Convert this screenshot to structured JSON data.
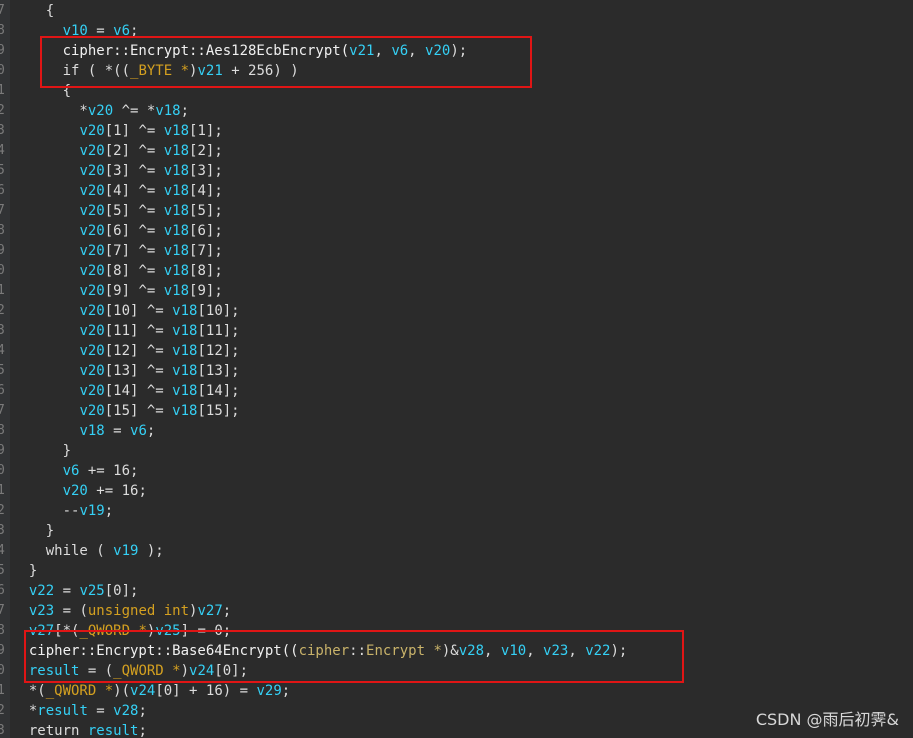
{
  "gutter": {
    "line_numbers": [
      "7",
      "8",
      "9",
      "0",
      "1",
      "2",
      "3",
      "4",
      "5",
      "6",
      "7",
      "8",
      "9",
      "0",
      "1",
      "2",
      "3",
      "4",
      "5",
      "6",
      "7",
      "8",
      "9",
      "0",
      "1",
      "2",
      "3",
      "4",
      "5",
      "6",
      "7",
      "8",
      "9",
      "0",
      "1",
      "2",
      "3"
    ]
  },
  "code": {
    "lines": [
      [
        {
          "t": "    {",
          "c": "plain"
        }
      ],
      [
        {
          "t": "      ",
          "c": "plain"
        },
        {
          "t": "v10",
          "c": "var"
        },
        {
          "t": " = ",
          "c": "plain"
        },
        {
          "t": "v6",
          "c": "var"
        },
        {
          "t": ";",
          "c": "plain"
        }
      ],
      [
        {
          "t": "      cipher::Encrypt::Aes128EcbEncrypt(",
          "c": "fn"
        },
        {
          "t": "v21",
          "c": "var"
        },
        {
          "t": ", ",
          "c": "plain"
        },
        {
          "t": "v6",
          "c": "var"
        },
        {
          "t": ", ",
          "c": "plain"
        },
        {
          "t": "v20",
          "c": "var"
        },
        {
          "t": ");",
          "c": "plain"
        }
      ],
      [
        {
          "t": "      if ( *((",
          "c": "plain"
        },
        {
          "t": "_BYTE *",
          "c": "kw"
        },
        {
          "t": ")",
          "c": "plain"
        },
        {
          "t": "v21",
          "c": "var"
        },
        {
          "t": " + 256) )",
          "c": "plain"
        }
      ],
      [
        {
          "t": "      {",
          "c": "plain"
        }
      ],
      [
        {
          "t": "        *",
          "c": "plain"
        },
        {
          "t": "v20",
          "c": "var"
        },
        {
          "t": " ^= *",
          "c": "plain"
        },
        {
          "t": "v18",
          "c": "var"
        },
        {
          "t": ";",
          "c": "plain"
        }
      ],
      [
        {
          "t": "        ",
          "c": "plain"
        },
        {
          "t": "v20",
          "c": "var"
        },
        {
          "t": "[1] ^= ",
          "c": "plain"
        },
        {
          "t": "v18",
          "c": "var"
        },
        {
          "t": "[1];",
          "c": "plain"
        }
      ],
      [
        {
          "t": "        ",
          "c": "plain"
        },
        {
          "t": "v20",
          "c": "var"
        },
        {
          "t": "[2] ^= ",
          "c": "plain"
        },
        {
          "t": "v18",
          "c": "var"
        },
        {
          "t": "[2];",
          "c": "plain"
        }
      ],
      [
        {
          "t": "        ",
          "c": "plain"
        },
        {
          "t": "v20",
          "c": "var"
        },
        {
          "t": "[3] ^= ",
          "c": "plain"
        },
        {
          "t": "v18",
          "c": "var"
        },
        {
          "t": "[3];",
          "c": "plain"
        }
      ],
      [
        {
          "t": "        ",
          "c": "plain"
        },
        {
          "t": "v20",
          "c": "var"
        },
        {
          "t": "[4] ^= ",
          "c": "plain"
        },
        {
          "t": "v18",
          "c": "var"
        },
        {
          "t": "[4];",
          "c": "plain"
        }
      ],
      [
        {
          "t": "        ",
          "c": "plain"
        },
        {
          "t": "v20",
          "c": "var"
        },
        {
          "t": "[5] ^= ",
          "c": "plain"
        },
        {
          "t": "v18",
          "c": "var"
        },
        {
          "t": "[5];",
          "c": "plain"
        }
      ],
      [
        {
          "t": "        ",
          "c": "plain"
        },
        {
          "t": "v20",
          "c": "var"
        },
        {
          "t": "[6] ^= ",
          "c": "plain"
        },
        {
          "t": "v18",
          "c": "var"
        },
        {
          "t": "[6];",
          "c": "plain"
        }
      ],
      [
        {
          "t": "        ",
          "c": "plain"
        },
        {
          "t": "v20",
          "c": "var"
        },
        {
          "t": "[7] ^= ",
          "c": "plain"
        },
        {
          "t": "v18",
          "c": "var"
        },
        {
          "t": "[7];",
          "c": "plain"
        }
      ],
      [
        {
          "t": "        ",
          "c": "plain"
        },
        {
          "t": "v20",
          "c": "var"
        },
        {
          "t": "[8] ^= ",
          "c": "plain"
        },
        {
          "t": "v18",
          "c": "var"
        },
        {
          "t": "[8];",
          "c": "plain"
        }
      ],
      [
        {
          "t": "        ",
          "c": "plain"
        },
        {
          "t": "v20",
          "c": "var"
        },
        {
          "t": "[9] ^= ",
          "c": "plain"
        },
        {
          "t": "v18",
          "c": "var"
        },
        {
          "t": "[9];",
          "c": "plain"
        }
      ],
      [
        {
          "t": "        ",
          "c": "plain"
        },
        {
          "t": "v20",
          "c": "var"
        },
        {
          "t": "[10] ^= ",
          "c": "plain"
        },
        {
          "t": "v18",
          "c": "var"
        },
        {
          "t": "[10];",
          "c": "plain"
        }
      ],
      [
        {
          "t": "        ",
          "c": "plain"
        },
        {
          "t": "v20",
          "c": "var"
        },
        {
          "t": "[11] ^= ",
          "c": "plain"
        },
        {
          "t": "v18",
          "c": "var"
        },
        {
          "t": "[11];",
          "c": "plain"
        }
      ],
      [
        {
          "t": "        ",
          "c": "plain"
        },
        {
          "t": "v20",
          "c": "var"
        },
        {
          "t": "[12] ^= ",
          "c": "plain"
        },
        {
          "t": "v18",
          "c": "var"
        },
        {
          "t": "[12];",
          "c": "plain"
        }
      ],
      [
        {
          "t": "        ",
          "c": "plain"
        },
        {
          "t": "v20",
          "c": "var"
        },
        {
          "t": "[13] ^= ",
          "c": "plain"
        },
        {
          "t": "v18",
          "c": "var"
        },
        {
          "t": "[13];",
          "c": "plain"
        }
      ],
      [
        {
          "t": "        ",
          "c": "plain"
        },
        {
          "t": "v20",
          "c": "var"
        },
        {
          "t": "[14] ^= ",
          "c": "plain"
        },
        {
          "t": "v18",
          "c": "var"
        },
        {
          "t": "[14];",
          "c": "plain"
        }
      ],
      [
        {
          "t": "        ",
          "c": "plain"
        },
        {
          "t": "v20",
          "c": "var"
        },
        {
          "t": "[15] ^= ",
          "c": "plain"
        },
        {
          "t": "v18",
          "c": "var"
        },
        {
          "t": "[15];",
          "c": "plain"
        }
      ],
      [
        {
          "t": "        ",
          "c": "plain"
        },
        {
          "t": "v18",
          "c": "var"
        },
        {
          "t": " = ",
          "c": "plain"
        },
        {
          "t": "v6",
          "c": "var"
        },
        {
          "t": ";",
          "c": "plain"
        }
      ],
      [
        {
          "t": "      }",
          "c": "plain"
        }
      ],
      [
        {
          "t": "      ",
          "c": "plain"
        },
        {
          "t": "v6",
          "c": "var"
        },
        {
          "t": " += 16;",
          "c": "plain"
        }
      ],
      [
        {
          "t": "      ",
          "c": "plain"
        },
        {
          "t": "v20",
          "c": "var"
        },
        {
          "t": " += 16;",
          "c": "plain"
        }
      ],
      [
        {
          "t": "      --",
          "c": "plain"
        },
        {
          "t": "v19",
          "c": "var"
        },
        {
          "t": ";",
          "c": "plain"
        }
      ],
      [
        {
          "t": "    }",
          "c": "plain"
        }
      ],
      [
        {
          "t": "    while ( ",
          "c": "plain"
        },
        {
          "t": "v19",
          "c": "var"
        },
        {
          "t": " );",
          "c": "plain"
        }
      ],
      [
        {
          "t": "  }",
          "c": "plain"
        }
      ],
      [
        {
          "t": "  ",
          "c": "plain"
        },
        {
          "t": "v22",
          "c": "var"
        },
        {
          "t": " = ",
          "c": "plain"
        },
        {
          "t": "v25",
          "c": "var"
        },
        {
          "t": "[0];",
          "c": "plain"
        }
      ],
      [
        {
          "t": "  ",
          "c": "plain"
        },
        {
          "t": "v23",
          "c": "var"
        },
        {
          "t": " = (",
          "c": "plain"
        },
        {
          "t": "unsigned int",
          "c": "kw"
        },
        {
          "t": ")",
          "c": "plain"
        },
        {
          "t": "v27",
          "c": "var"
        },
        {
          "t": ";",
          "c": "plain"
        }
      ],
      [
        {
          "t": "  ",
          "c": "plain"
        },
        {
          "t": "v27",
          "c": "var"
        },
        {
          "t": "[*(",
          "c": "plain"
        },
        {
          "t": "_QWORD *",
          "c": "kw"
        },
        {
          "t": ")",
          "c": "plain"
        },
        {
          "t": "v25",
          "c": "var"
        },
        {
          "t": "] = 0;",
          "c": "plain"
        }
      ],
      [
        {
          "t": "  cipher::Encrypt::Base64Encrypt((",
          "c": "fn"
        },
        {
          "t": "cipher",
          "c": "ns"
        },
        {
          "t": "::",
          "c": "plain"
        },
        {
          "t": "Encrypt *",
          "c": "ns"
        },
        {
          "t": ")&",
          "c": "plain"
        },
        {
          "t": "v28",
          "c": "var"
        },
        {
          "t": ", ",
          "c": "plain"
        },
        {
          "t": "v10",
          "c": "var"
        },
        {
          "t": ", ",
          "c": "plain"
        },
        {
          "t": "v23",
          "c": "var"
        },
        {
          "t": ", ",
          "c": "plain"
        },
        {
          "t": "v22",
          "c": "var"
        },
        {
          "t": ");",
          "c": "plain"
        }
      ],
      [
        {
          "t": "  ",
          "c": "plain"
        },
        {
          "t": "result",
          "c": "var"
        },
        {
          "t": " = (",
          "c": "plain"
        },
        {
          "t": "_QWORD *",
          "c": "kw"
        },
        {
          "t": ")",
          "c": "plain"
        },
        {
          "t": "v24",
          "c": "var"
        },
        {
          "t": "[0];",
          "c": "plain"
        }
      ],
      [
        {
          "t": "  *(",
          "c": "plain"
        },
        {
          "t": "_QWORD *",
          "c": "kw"
        },
        {
          "t": ")(",
          "c": "plain"
        },
        {
          "t": "v24",
          "c": "var"
        },
        {
          "t": "[0] + 16) = ",
          "c": "plain"
        },
        {
          "t": "v29",
          "c": "var"
        },
        {
          "t": ";",
          "c": "plain"
        }
      ],
      [
        {
          "t": "  *",
          "c": "plain"
        },
        {
          "t": "result",
          "c": "var"
        },
        {
          "t": " = ",
          "c": "plain"
        },
        {
          "t": "v28",
          "c": "var"
        },
        {
          "t": ";",
          "c": "plain"
        }
      ],
      [
        {
          "t": "  return ",
          "c": "plain"
        },
        {
          "t": "result",
          "c": "var"
        },
        {
          "t": ";",
          "c": "plain"
        }
      ]
    ]
  },
  "colors": {
    "background": "#2b2b2b",
    "variable": "#35d0f5",
    "keyword_type": "#d4a020",
    "highlight_border": "#e01515"
  },
  "watermark": {
    "text": "CSDN @雨后初霁&"
  }
}
